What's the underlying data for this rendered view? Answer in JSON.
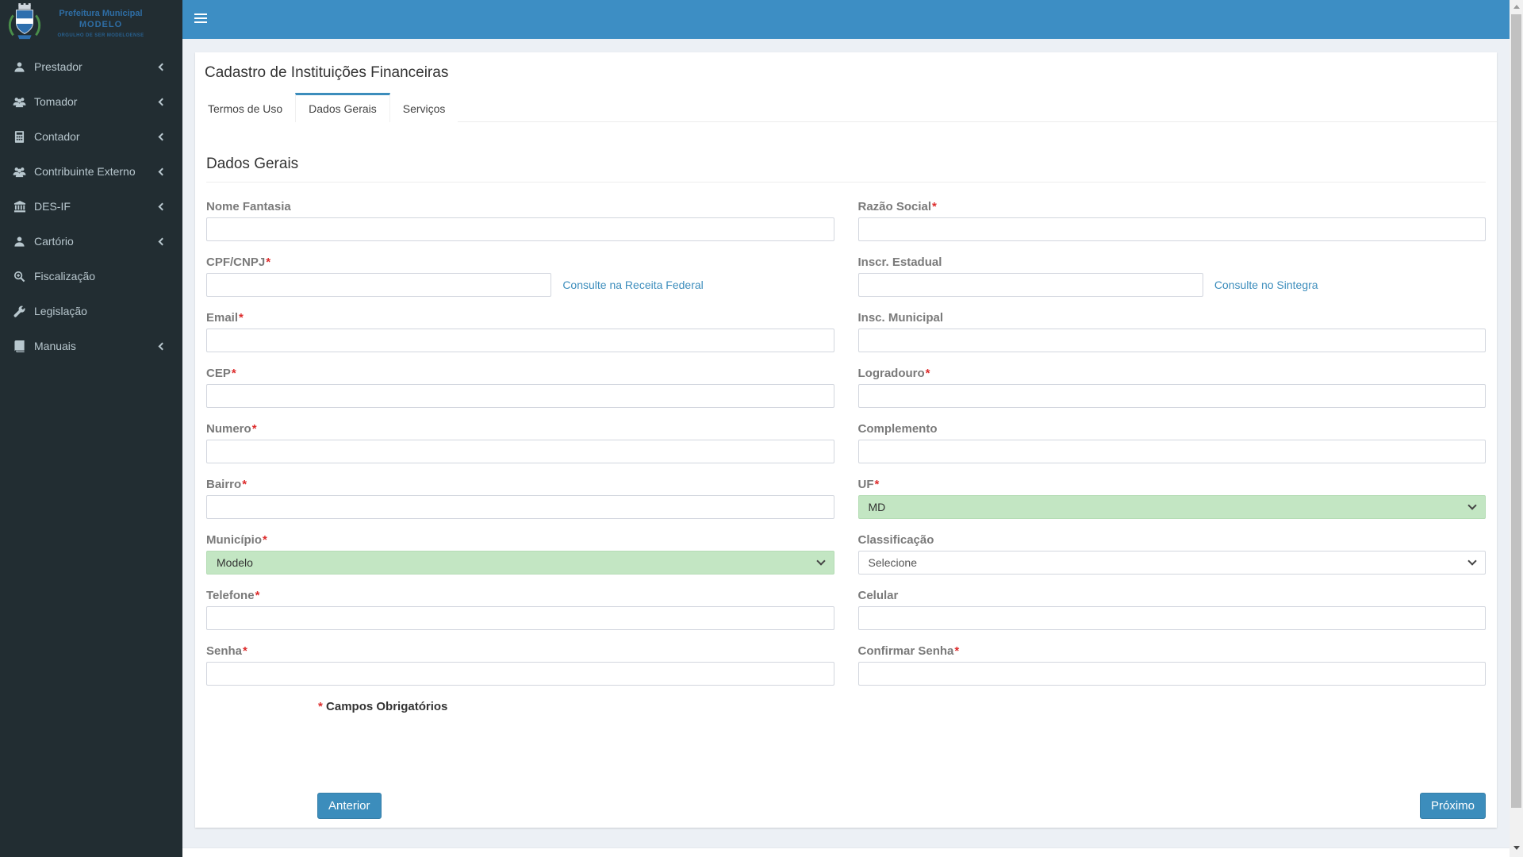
{
  "brand": {
    "line1": "Prefeitura Municipal",
    "line2": "MODELO",
    "tagline": "ORGULHO DE SER MODELOENSE",
    "logo": "coat-of-arms"
  },
  "topbar": {
    "menu_icon": "hamburger-icon",
    "color": "#3d8ec4"
  },
  "sidebar": {
    "bg_color": "#222d32",
    "items": [
      {
        "label": "Prestador",
        "icon": "user-icon",
        "has_submenu": true
      },
      {
        "label": "Tomador",
        "icon": "users-icon",
        "has_submenu": true
      },
      {
        "label": "Contador",
        "icon": "calculator-icon",
        "has_submenu": true
      },
      {
        "label": "Contribuinte Externo",
        "icon": "users-icon",
        "has_submenu": true
      },
      {
        "label": "DES-IF",
        "icon": "bank-icon",
        "has_submenu": true
      },
      {
        "label": "Cartório",
        "icon": "user-icon",
        "has_submenu": true
      },
      {
        "label": "Fiscalização",
        "icon": "search-plus-icon",
        "has_submenu": false
      },
      {
        "label": "Legislação",
        "icon": "wrench-icon",
        "has_submenu": false
      },
      {
        "label": "Manuais",
        "icon": "book-icon",
        "has_submenu": true
      }
    ]
  },
  "page": {
    "title": "Cadastro de Instituições Financeiras"
  },
  "tabs": [
    {
      "label": "Termos de Uso",
      "active": false
    },
    {
      "label": "Dados Gerais",
      "active": true
    },
    {
      "label": "Serviços",
      "active": false
    }
  ],
  "section": {
    "heading": "Dados Gerais"
  },
  "form": {
    "required_mark": "*",
    "required_note": "Campos Obrigatórios",
    "fields": [
      {
        "label": "Nome Fantasia",
        "required": false,
        "control": "input",
        "value": ""
      },
      {
        "label": "Razão Social",
        "required": true,
        "control": "input",
        "value": ""
      },
      {
        "label": "CPF/CNPJ",
        "required": true,
        "control": "input",
        "value": "",
        "link": "Consulte na Receita Federal",
        "half": true
      },
      {
        "label": "Inscr. Estadual",
        "required": false,
        "control": "input",
        "value": "",
        "link": "Consulte no Sintegra",
        "half": true
      },
      {
        "label": "Email",
        "required": true,
        "control": "input",
        "value": ""
      },
      {
        "label": "Insc. Municipal",
        "required": false,
        "control": "input",
        "value": ""
      },
      {
        "label": "CEP",
        "required": true,
        "control": "input",
        "value": ""
      },
      {
        "label": "Logradouro",
        "required": true,
        "control": "input",
        "value": ""
      },
      {
        "label": "Numero",
        "required": true,
        "control": "input",
        "value": ""
      },
      {
        "label": "Complemento",
        "required": false,
        "control": "input",
        "value": ""
      },
      {
        "label": "Bairro",
        "required": true,
        "control": "input",
        "value": ""
      },
      {
        "label": "UF",
        "required": true,
        "control": "select",
        "value": "MD",
        "highlighted": true
      },
      {
        "label": "Município",
        "required": true,
        "control": "select",
        "value": "Modelo",
        "highlighted": true
      },
      {
        "label": "Classificação",
        "required": false,
        "control": "select",
        "value": "Selecione",
        "highlighted": false
      },
      {
        "label": "Telefone",
        "required": true,
        "control": "input",
        "value": ""
      },
      {
        "label": "Celular",
        "required": false,
        "control": "input",
        "value": ""
      },
      {
        "label": "Senha",
        "required": true,
        "control": "input",
        "value": "",
        "input_type": "password"
      },
      {
        "label": "Confirmar Senha",
        "required": true,
        "control": "input",
        "value": "",
        "input_type": "password"
      }
    ]
  },
  "buttons": {
    "previous": "Anterior",
    "next": "Próximo"
  },
  "colors": {
    "accent": "#3c8dbc",
    "topbar": "#3d8ec4",
    "sidebar_bg": "#222d32",
    "content_bg": "#ecf0f5",
    "select_highlight": "#c3e6c3",
    "required": "#dd2c2c"
  }
}
